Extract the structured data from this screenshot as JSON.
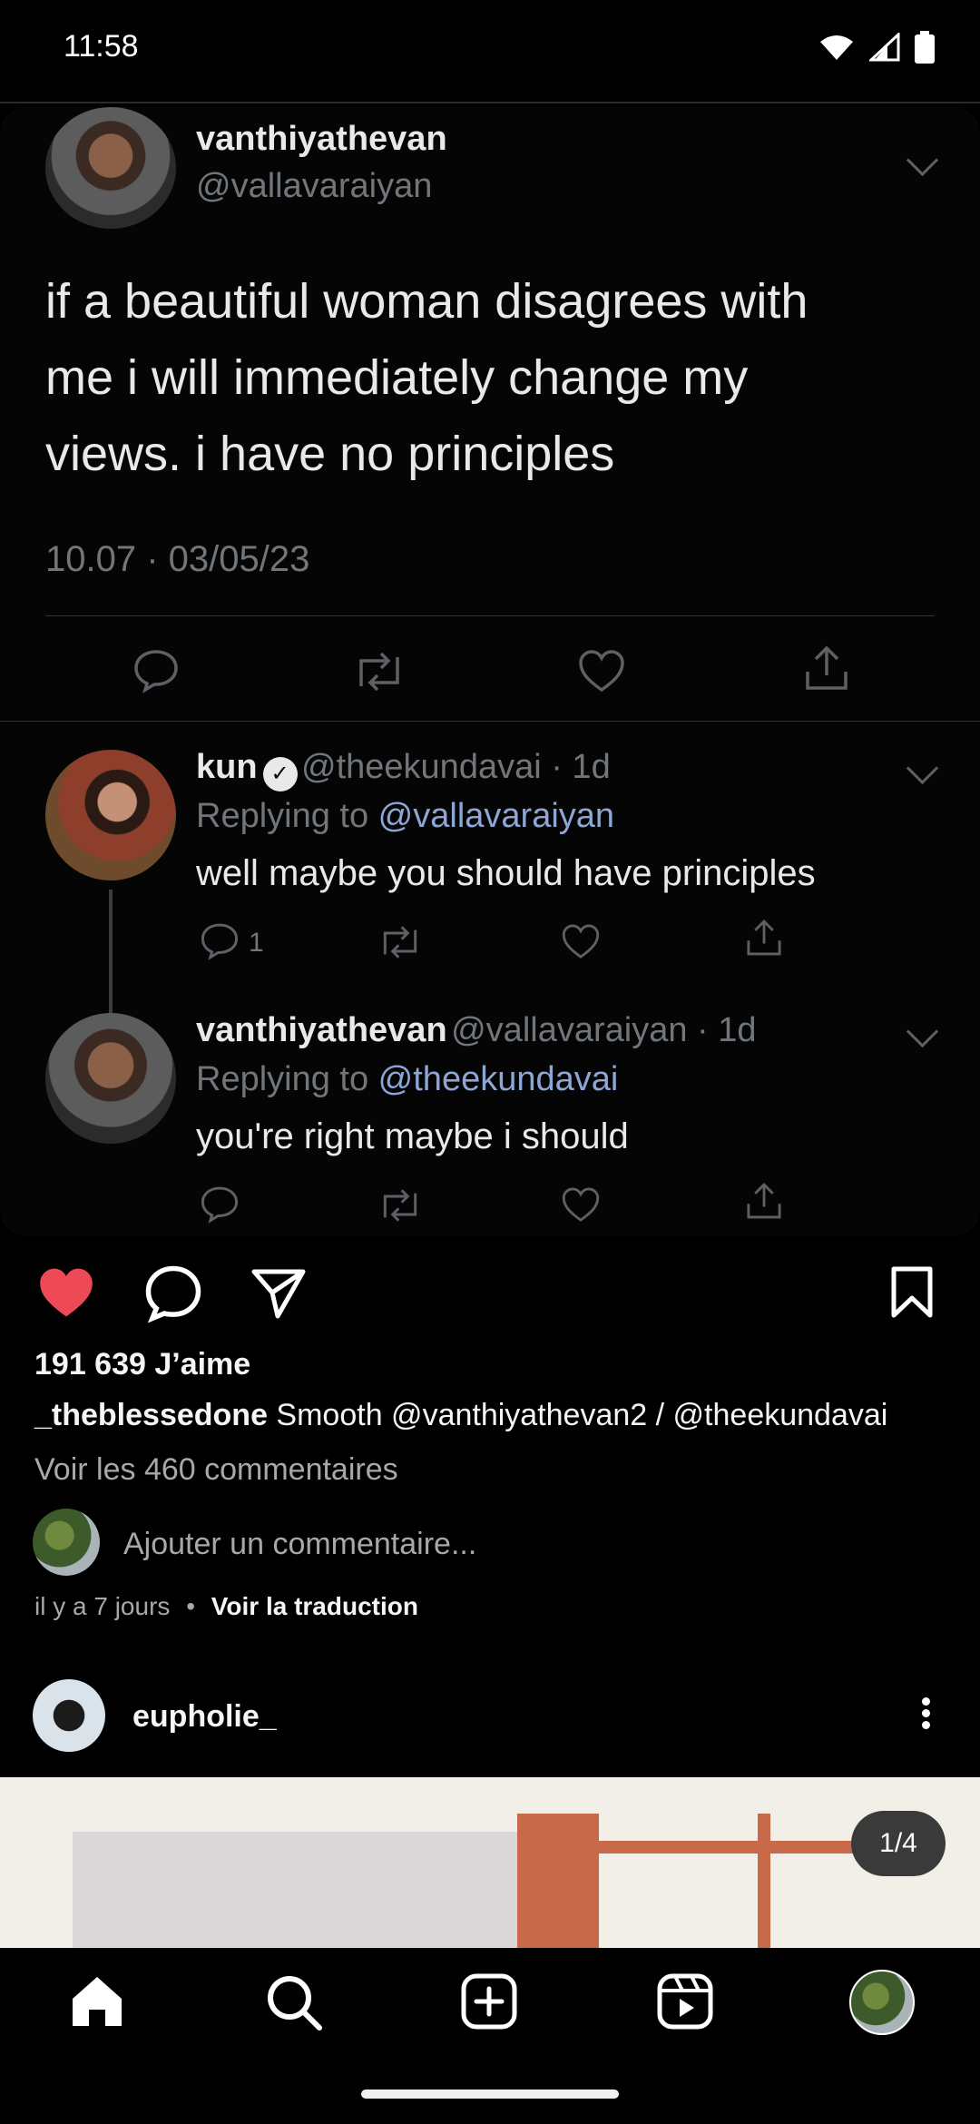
{
  "status_bar": {
    "time": "11:58"
  },
  "tweet": {
    "author_name": "vanthiyathevan",
    "author_handle": "@vallavaraiyan",
    "body_lines": [
      "if a beautiful woman disagrees with",
      "me i will immediately change my",
      "views. i have no principles"
    ],
    "timestamp": "10.07 · 03/05/23"
  },
  "replies": [
    {
      "name": "kun",
      "handle_time": "@theekundavai · 1d",
      "replying_prefix": "Replying to ",
      "replying_to": "@vallavaraiyan",
      "text": "well maybe you should have principles",
      "reply_count": "1"
    },
    {
      "name": "vanthiyathevan",
      "handle_time": "@vallavaraiyan · 1d",
      "replying_prefix": "Replying to ",
      "replying_to": "@theekundavai",
      "text": "you're right maybe i should"
    }
  ],
  "post": {
    "likes": "191 639 J’aime",
    "caption_user": "_theblessedone",
    "caption_text": " Smooth @vanthiyathevan2 / @theekundavai",
    "view_comments": "Voir les 460 commentaires",
    "add_comment_placeholder": "Ajouter un commentaire...",
    "time_ago": "il y a 7 jours",
    "separator": "•",
    "translate": "Voir la traduction"
  },
  "next_post": {
    "username": "eupholie_",
    "page_indicator": "1/4"
  },
  "colors": {
    "like_red": "#ed4956",
    "mention_blue": "#8ea6d6",
    "muted": "#71767b"
  },
  "icons": [
    "heart-icon",
    "comment-icon",
    "share-icon",
    "bookmark-icon",
    "home-icon",
    "search-icon",
    "create-icon",
    "reels-icon"
  ]
}
